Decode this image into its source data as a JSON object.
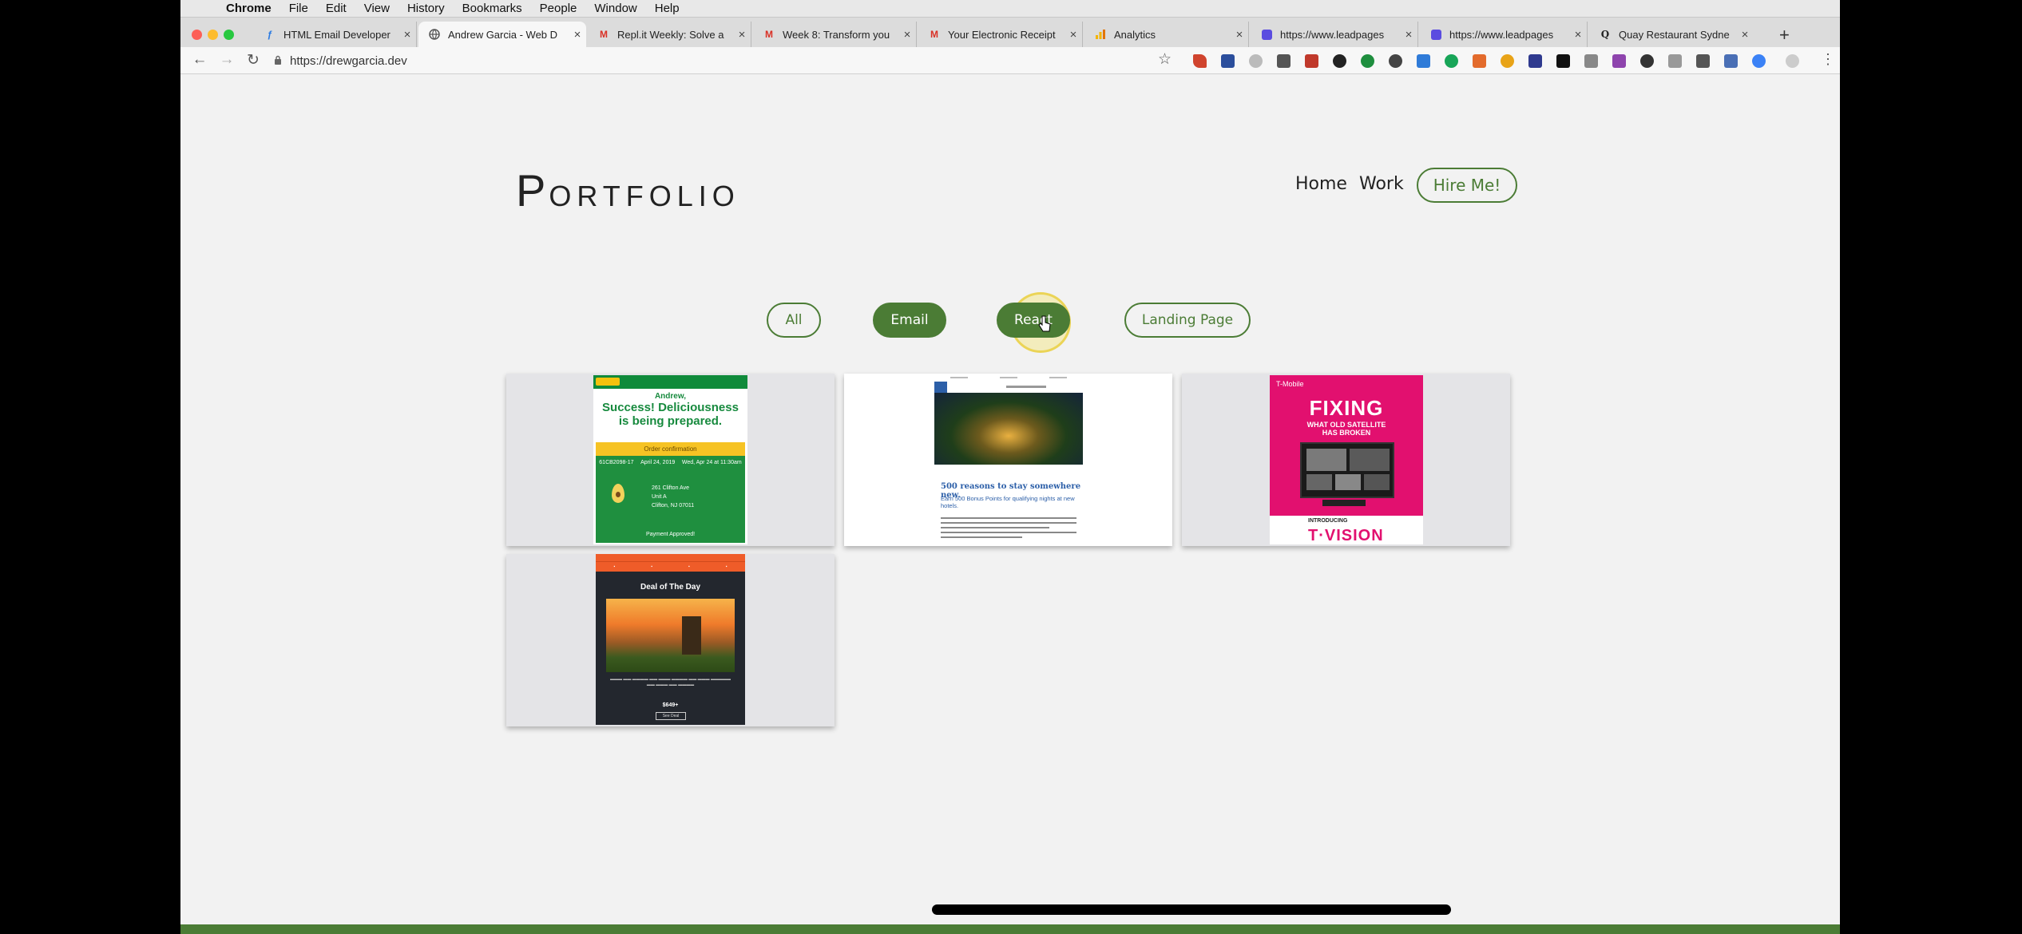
{
  "menubar": {
    "items": [
      "Chrome",
      "File",
      "Edit",
      "View",
      "History",
      "Bookmarks",
      "People",
      "Window",
      "Help"
    ]
  },
  "tabs": [
    {
      "title": "HTML Email Developer",
      "icon": "quill-icon",
      "active": false
    },
    {
      "title": "Andrew Garcia - Web D",
      "icon": "globe-icon",
      "active": true
    },
    {
      "title": "Repl.it Weekly: Solve a",
      "icon": "gmail-icon",
      "active": false
    },
    {
      "title": "Week 8: Transform you",
      "icon": "gmail-icon",
      "active": false
    },
    {
      "title": "Your Electronic Receipt",
      "icon": "gmail-icon",
      "active": false
    },
    {
      "title": "Analytics",
      "icon": "analytics-icon",
      "active": false
    },
    {
      "title": "https://www.leadpages",
      "icon": "leadpages-icon",
      "active": false
    },
    {
      "title": "https://www.leadpages",
      "icon": "leadpages-icon",
      "active": false
    },
    {
      "title": "Quay Restaurant Sydne",
      "icon": "quora-icon",
      "active": false
    }
  ],
  "toolbar": {
    "url": "https://drewgarcia.dev"
  },
  "site": {
    "logo_initial": "P",
    "logo_rest": "ORTFOLIO",
    "nav": {
      "home": "Home",
      "work": "Work",
      "hire": "Hire Me!"
    },
    "filters": [
      {
        "label": "All",
        "state": "outline"
      },
      {
        "label": "Email",
        "state": "filled"
      },
      {
        "label": "React",
        "state": "filled"
      },
      {
        "label": "Landing Page",
        "state": "outline"
      }
    ]
  },
  "portfolio": {
    "subway": {
      "greeting": "Andrew,",
      "headline_1": "Success! Deliciousness",
      "headline_2": "is being prepared.",
      "order_confirmation": "Order confirmation",
      "order_number": "61CB2098-17",
      "order_date": "April 24, 2019",
      "pickup": "Wed, Apr 24 at 11:30am",
      "address_1": "261 Clifton Ave",
      "address_2": "Unit A",
      "address_3": "Clifton, NJ 07011",
      "payment": "Payment Approved!"
    },
    "hotel": {
      "headline": "500 reasons to stay somewhere new.",
      "subhead": "Earn 500 Bonus Points for qualifying nights at new hotels."
    },
    "tmobile": {
      "brand": "T-Mobile",
      "headline": "FIXING",
      "subhead_1": "WHAT OLD SATELLITE",
      "subhead_2": "HAS BROKEN",
      "intro": "INTRODUCING",
      "product": "T·VISION"
    },
    "deal": {
      "headline": "Deal of The Day",
      "price": "$649+",
      "button": "See Deal"
    }
  },
  "colors": {
    "accent_green": "#4b7c35",
    "page_bg": "#f2f2f2"
  }
}
